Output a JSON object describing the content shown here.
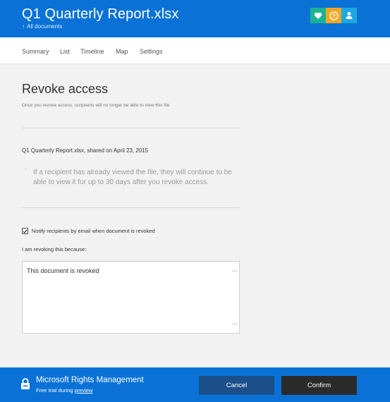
{
  "header": {
    "title": "Q1 Quarterly Report.xlsx",
    "back_label": "All documents",
    "buttons": [
      {
        "icon": "heart-icon",
        "color": "#1ab394"
      },
      {
        "icon": "help-icon",
        "color": "#f5a623"
      },
      {
        "icon": "user-icon",
        "color": "#1ea7e1"
      }
    ]
  },
  "tabs": [
    "Summary",
    "List",
    "Timeline",
    "Map",
    "Settings"
  ],
  "main": {
    "title": "Revoke access",
    "subtitle": "Once you revoke access, recipients will no longer be able to view this file",
    "file_line": "Q1 Quarterly Report.xlsx, shared on April 23, 2015",
    "note": "If a recipient has already viewed the file, they will continue to be able to view it for up to 30 days after you revoke access.",
    "notify_label": "Notify recipients by email when document is revoked",
    "notify_checked": true,
    "reason_label": "I am revoking this because:",
    "reason_value": "This document is revoked"
  },
  "footer": {
    "brand": "Microsoft Rights Management",
    "trial_prefix": "Free trial during ",
    "trial_link": "preview",
    "cancel_label": "Cancel",
    "confirm_label": "Confirm"
  }
}
